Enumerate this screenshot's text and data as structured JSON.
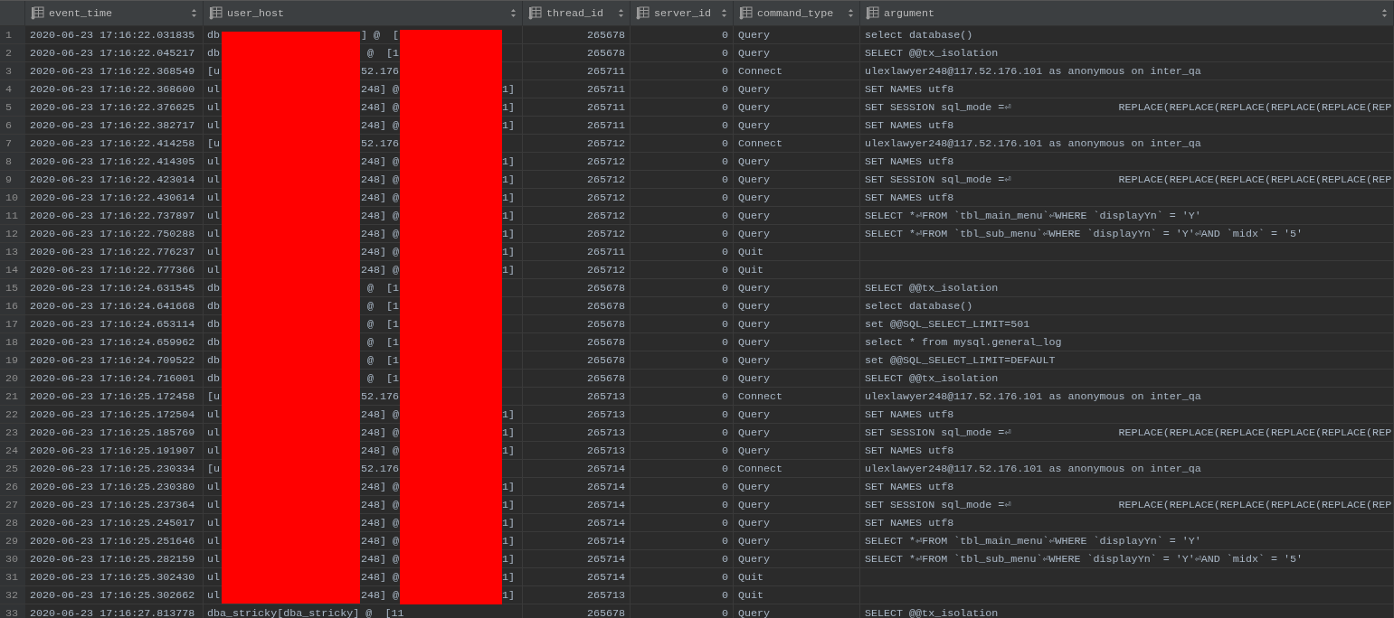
{
  "columns": [
    {
      "kind": "time",
      "label": "event_time"
    },
    {
      "kind": "host",
      "label": "user_host"
    },
    {
      "kind": "thread",
      "label": "thread_id"
    },
    {
      "kind": "server",
      "label": "server_id"
    },
    {
      "kind": "command",
      "label": "command_type"
    },
    {
      "kind": "argument",
      "label": "argument"
    }
  ],
  "rows": [
    {
      "n": "1",
      "event_time": "2020-06-23 17:16:22.031835",
      "host": {
        "left": "db",
        "middle": "] @  ["
      },
      "thread_id": "265678",
      "server_id": "0",
      "command_type": "Query",
      "argument": "select database()"
    },
    {
      "n": "2",
      "event_time": "2020-06-23 17:16:22.045217",
      "host": {
        "left": "db",
        "middle": "@  [1"
      },
      "thread_id": "265678",
      "server_id": "0",
      "command_type": "Query",
      "argument": "SELECT @@tx_isolation"
    },
    {
      "n": "3",
      "event_time": "2020-06-23 17:16:22.368549",
      "host": {
        "left": "[u",
        "middle": "52.176"
      },
      "thread_id": "265711",
      "server_id": "0",
      "command_type": "Connect",
      "argument": "ulexlawyer248@117.52.176.101 as anonymous on inter_qa"
    },
    {
      "n": "4",
      "event_time": "2020-06-23 17:16:22.368600",
      "host": {
        "left": "ul",
        "middle": "248] @",
        "right": "1]"
      },
      "thread_id": "265711",
      "server_id": "0",
      "command_type": "Query",
      "argument": "SET NAMES utf8"
    },
    {
      "n": "5",
      "event_time": "2020-06-23 17:16:22.376625",
      "host": {
        "left": "ul",
        "middle": "248] @",
        "right": "1]"
      },
      "thread_id": "265711",
      "server_id": "0",
      "command_type": "Query",
      "argument": "SET SESSION sql_mode =⏎                 REPLACE(REPLACE(REPLACE(REPLACE(REPLACE(REP"
    },
    {
      "n": "6",
      "event_time": "2020-06-23 17:16:22.382717",
      "host": {
        "left": "ul",
        "middle": "248] @",
        "right": "1]"
      },
      "thread_id": "265711",
      "server_id": "0",
      "command_type": "Query",
      "argument": "SET NAMES utf8"
    },
    {
      "n": "7",
      "event_time": "2020-06-23 17:16:22.414258",
      "host": {
        "left": "[u",
        "middle": "52.176"
      },
      "thread_id": "265712",
      "server_id": "0",
      "command_type": "Connect",
      "argument": "ulexlawyer248@117.52.176.101 as anonymous on inter_qa"
    },
    {
      "n": "8",
      "event_time": "2020-06-23 17:16:22.414305",
      "host": {
        "left": "ul",
        "middle": "248] @",
        "right": "1]"
      },
      "thread_id": "265712",
      "server_id": "0",
      "command_type": "Query",
      "argument": "SET NAMES utf8"
    },
    {
      "n": "9",
      "event_time": "2020-06-23 17:16:22.423014",
      "host": {
        "left": "ul",
        "middle": "248] @",
        "right": "1]"
      },
      "thread_id": "265712",
      "server_id": "0",
      "command_type": "Query",
      "argument": "SET SESSION sql_mode =⏎                 REPLACE(REPLACE(REPLACE(REPLACE(REPLACE(REP"
    },
    {
      "n": "10",
      "event_time": "2020-06-23 17:16:22.430614",
      "host": {
        "left": "ul",
        "middle": "248] @",
        "right": "1]"
      },
      "thread_id": "265712",
      "server_id": "0",
      "command_type": "Query",
      "argument": "SET NAMES utf8"
    },
    {
      "n": "11",
      "event_time": "2020-06-23 17:16:22.737897",
      "host": {
        "left": "ul",
        "middle": "248] @",
        "right": "1]"
      },
      "thread_id": "265712",
      "server_id": "0",
      "command_type": "Query",
      "argument": "SELECT *⏎FROM `tbl_main_menu`⏎WHERE `displayYn` = 'Y'"
    },
    {
      "n": "12",
      "event_time": "2020-06-23 17:16:22.750288",
      "host": {
        "left": "ul",
        "middle": "248] @",
        "right": "1]"
      },
      "thread_id": "265712",
      "server_id": "0",
      "command_type": "Query",
      "argument": "SELECT *⏎FROM `tbl_sub_menu`⏎WHERE `displayYn` = 'Y'⏎AND `midx` = '5'"
    },
    {
      "n": "13",
      "event_time": "2020-06-23 17:16:22.776237",
      "host": {
        "left": "ul",
        "middle": "248] @",
        "right": "1]"
      },
      "thread_id": "265711",
      "server_id": "0",
      "command_type": "Quit"
    },
    {
      "n": "14",
      "event_time": "2020-06-23 17:16:22.777366",
      "host": {
        "left": "ul",
        "middle": "248] @",
        "right": "1]"
      },
      "thread_id": "265712",
      "server_id": "0",
      "command_type": "Quit"
    },
    {
      "n": "15",
      "event_time": "2020-06-23 17:16:24.631545",
      "host": {
        "left": "db",
        "middle": "@  [1"
      },
      "thread_id": "265678",
      "server_id": "0",
      "command_type": "Query",
      "argument": "SELECT @@tx_isolation"
    },
    {
      "n": "16",
      "event_time": "2020-06-23 17:16:24.641668",
      "host": {
        "left": "db",
        "middle": "@  [1"
      },
      "thread_id": "265678",
      "server_id": "0",
      "command_type": "Query",
      "argument": "select database()"
    },
    {
      "n": "17",
      "event_time": "2020-06-23 17:16:24.653114",
      "host": {
        "left": "db",
        "middle": "@  [1"
      },
      "thread_id": "265678",
      "server_id": "0",
      "command_type": "Query",
      "argument": "set @@SQL_SELECT_LIMIT=501"
    },
    {
      "n": "18",
      "event_time": "2020-06-23 17:16:24.659962",
      "host": {
        "left": "db",
        "middle": "@  [1"
      },
      "thread_id": "265678",
      "server_id": "0",
      "command_type": "Query",
      "argument": "select * from mysql.general_log"
    },
    {
      "n": "19",
      "event_time": "2020-06-23 17:16:24.709522",
      "host": {
        "left": "db",
        "middle": "@  [1"
      },
      "thread_id": "265678",
      "server_id": "0",
      "command_type": "Query",
      "argument": "set @@SQL_SELECT_LIMIT=DEFAULT"
    },
    {
      "n": "20",
      "event_time": "2020-06-23 17:16:24.716001",
      "host": {
        "left": "db",
        "middle": "@  [1"
      },
      "thread_id": "265678",
      "server_id": "0",
      "command_type": "Query",
      "argument": "SELECT @@tx_isolation"
    },
    {
      "n": "21",
      "event_time": "2020-06-23 17:16:25.172458",
      "host": {
        "left": "[u",
        "middle": "52.176"
      },
      "thread_id": "265713",
      "server_id": "0",
      "command_type": "Connect",
      "argument": "ulexlawyer248@117.52.176.101 as anonymous on inter_qa"
    },
    {
      "n": "22",
      "event_time": "2020-06-23 17:16:25.172504",
      "host": {
        "left": "ul",
        "middle": "248] @",
        "right": "1]"
      },
      "thread_id": "265713",
      "server_id": "0",
      "command_type": "Query",
      "argument": "SET NAMES utf8"
    },
    {
      "n": "23",
      "event_time": "2020-06-23 17:16:25.185769",
      "host": {
        "left": "ul",
        "middle": "248] @",
        "right": "1]"
      },
      "thread_id": "265713",
      "server_id": "0",
      "command_type": "Query",
      "argument": "SET SESSION sql_mode =⏎                 REPLACE(REPLACE(REPLACE(REPLACE(REPLACE(REP"
    },
    {
      "n": "24",
      "event_time": "2020-06-23 17:16:25.191907",
      "host": {
        "left": "ul",
        "middle": "248] @",
        "right": "1]"
      },
      "thread_id": "265713",
      "server_id": "0",
      "command_type": "Query",
      "argument": "SET NAMES utf8"
    },
    {
      "n": "25",
      "event_time": "2020-06-23 17:16:25.230334",
      "host": {
        "left": "[u",
        "middle": "52.176"
      },
      "thread_id": "265714",
      "server_id": "0",
      "command_type": "Connect",
      "argument": "ulexlawyer248@117.52.176.101 as anonymous on inter_qa"
    },
    {
      "n": "26",
      "event_time": "2020-06-23 17:16:25.230380",
      "host": {
        "left": "ul",
        "middle": "248] @",
        "right": "1]"
      },
      "thread_id": "265714",
      "server_id": "0",
      "command_type": "Query",
      "argument": "SET NAMES utf8"
    },
    {
      "n": "27",
      "event_time": "2020-06-23 17:16:25.237364",
      "host": {
        "left": "ul",
        "middle": "248] @",
        "right": "1]"
      },
      "thread_id": "265714",
      "server_id": "0",
      "command_type": "Query",
      "argument": "SET SESSION sql_mode =⏎                 REPLACE(REPLACE(REPLACE(REPLACE(REPLACE(REP"
    },
    {
      "n": "28",
      "event_time": "2020-06-23 17:16:25.245017",
      "host": {
        "left": "ul",
        "middle": "248] @",
        "right": "1]"
      },
      "thread_id": "265714",
      "server_id": "0",
      "command_type": "Query",
      "argument": "SET NAMES utf8"
    },
    {
      "n": "29",
      "event_time": "2020-06-23 17:16:25.251646",
      "host": {
        "left": "ul",
        "middle": "248] @",
        "right": "1]"
      },
      "thread_id": "265714",
      "server_id": "0",
      "command_type": "Query",
      "argument": "SELECT *⏎FROM `tbl_main_menu`⏎WHERE `displayYn` = 'Y'"
    },
    {
      "n": "30",
      "event_time": "2020-06-23 17:16:25.282159",
      "host": {
        "left": "ul",
        "middle": "248] @",
        "right": "1]"
      },
      "thread_id": "265714",
      "server_id": "0",
      "command_type": "Query",
      "argument": "SELECT *⏎FROM `tbl_sub_menu`⏎WHERE `displayYn` = 'Y'⏎AND `midx` = '5'"
    },
    {
      "n": "31",
      "event_time": "2020-06-23 17:16:25.302430",
      "host": {
        "left": "ul",
        "middle": "248] @",
        "right": "1]"
      },
      "thread_id": "265714",
      "server_id": "0",
      "command_type": "Quit"
    },
    {
      "n": "32",
      "event_time": "2020-06-23 17:16:25.302662",
      "host": {
        "left": "ul",
        "middle": "248] @",
        "right": "1]"
      },
      "thread_id": "265713",
      "server_id": "0",
      "command_type": "Quit"
    },
    {
      "n": "33",
      "event_time": "2020-06-23 17:16:27.813778",
      "host": {
        "left": "dba_stricky[dba_stricky] @  [11"
      },
      "thread_id": "265678",
      "server_id": "0",
      "command_type": "Query",
      "argument": "SELECT @@tx_isolation"
    }
  ]
}
